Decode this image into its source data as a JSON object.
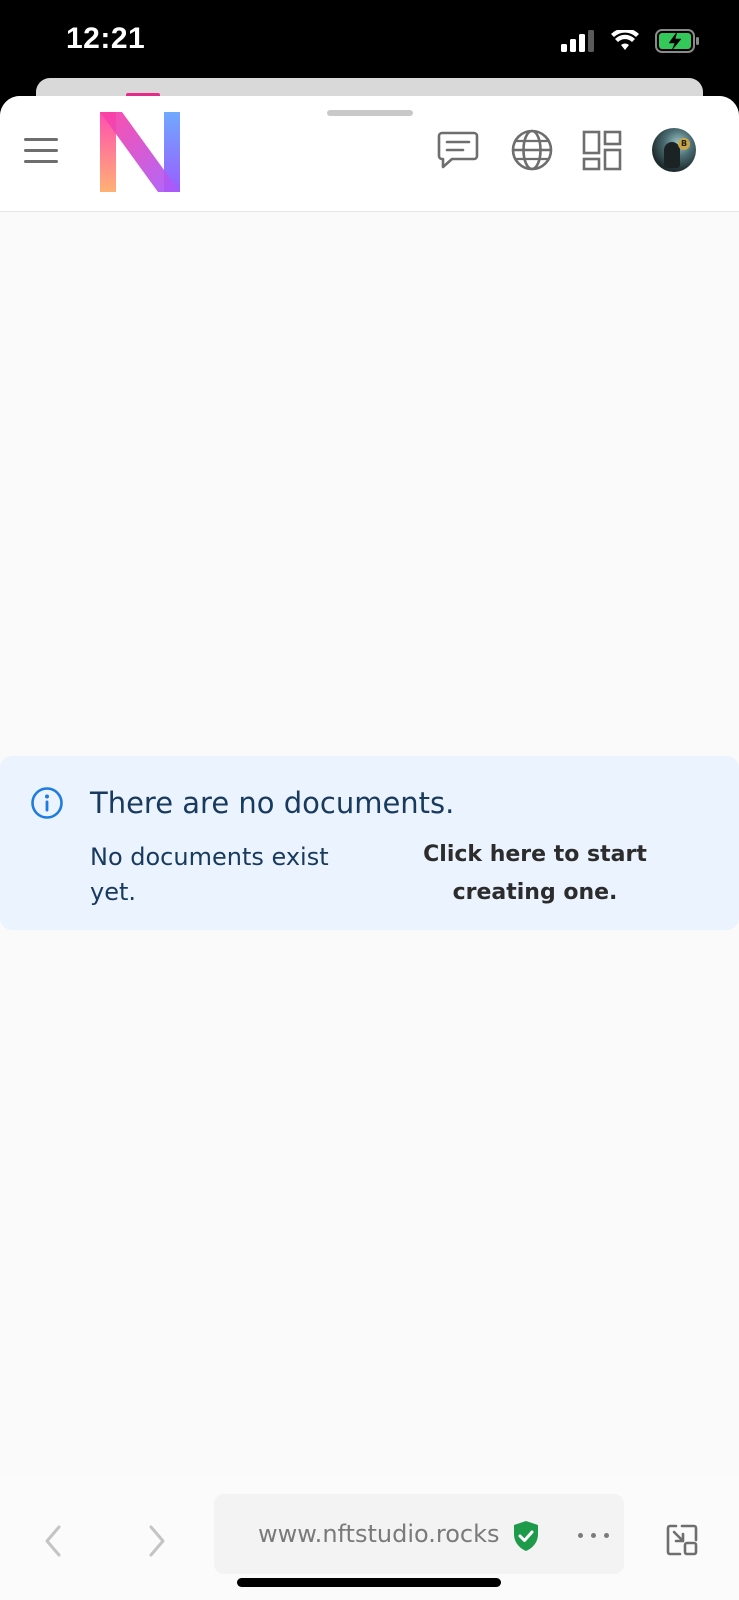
{
  "status_bar": {
    "time": "12:21"
  },
  "header": {
    "menu_icon": "hamburger-menu-icon",
    "logo": "brand-n-logo",
    "icons": [
      "chat-icon",
      "globe-icon",
      "dashboard-grid-icon",
      "avatar"
    ]
  },
  "alert": {
    "title": "There are no documents.",
    "body": "No documents exist yet.",
    "link": "Click here to start creating one.",
    "icon": "info-icon",
    "accent_color": "#1e7be0",
    "background_color": "#ebf3fe"
  },
  "browser": {
    "url": "www.nftstudio.rocks",
    "secure_icon": "shield-check-icon",
    "secure_color": "#1e9b4a"
  }
}
